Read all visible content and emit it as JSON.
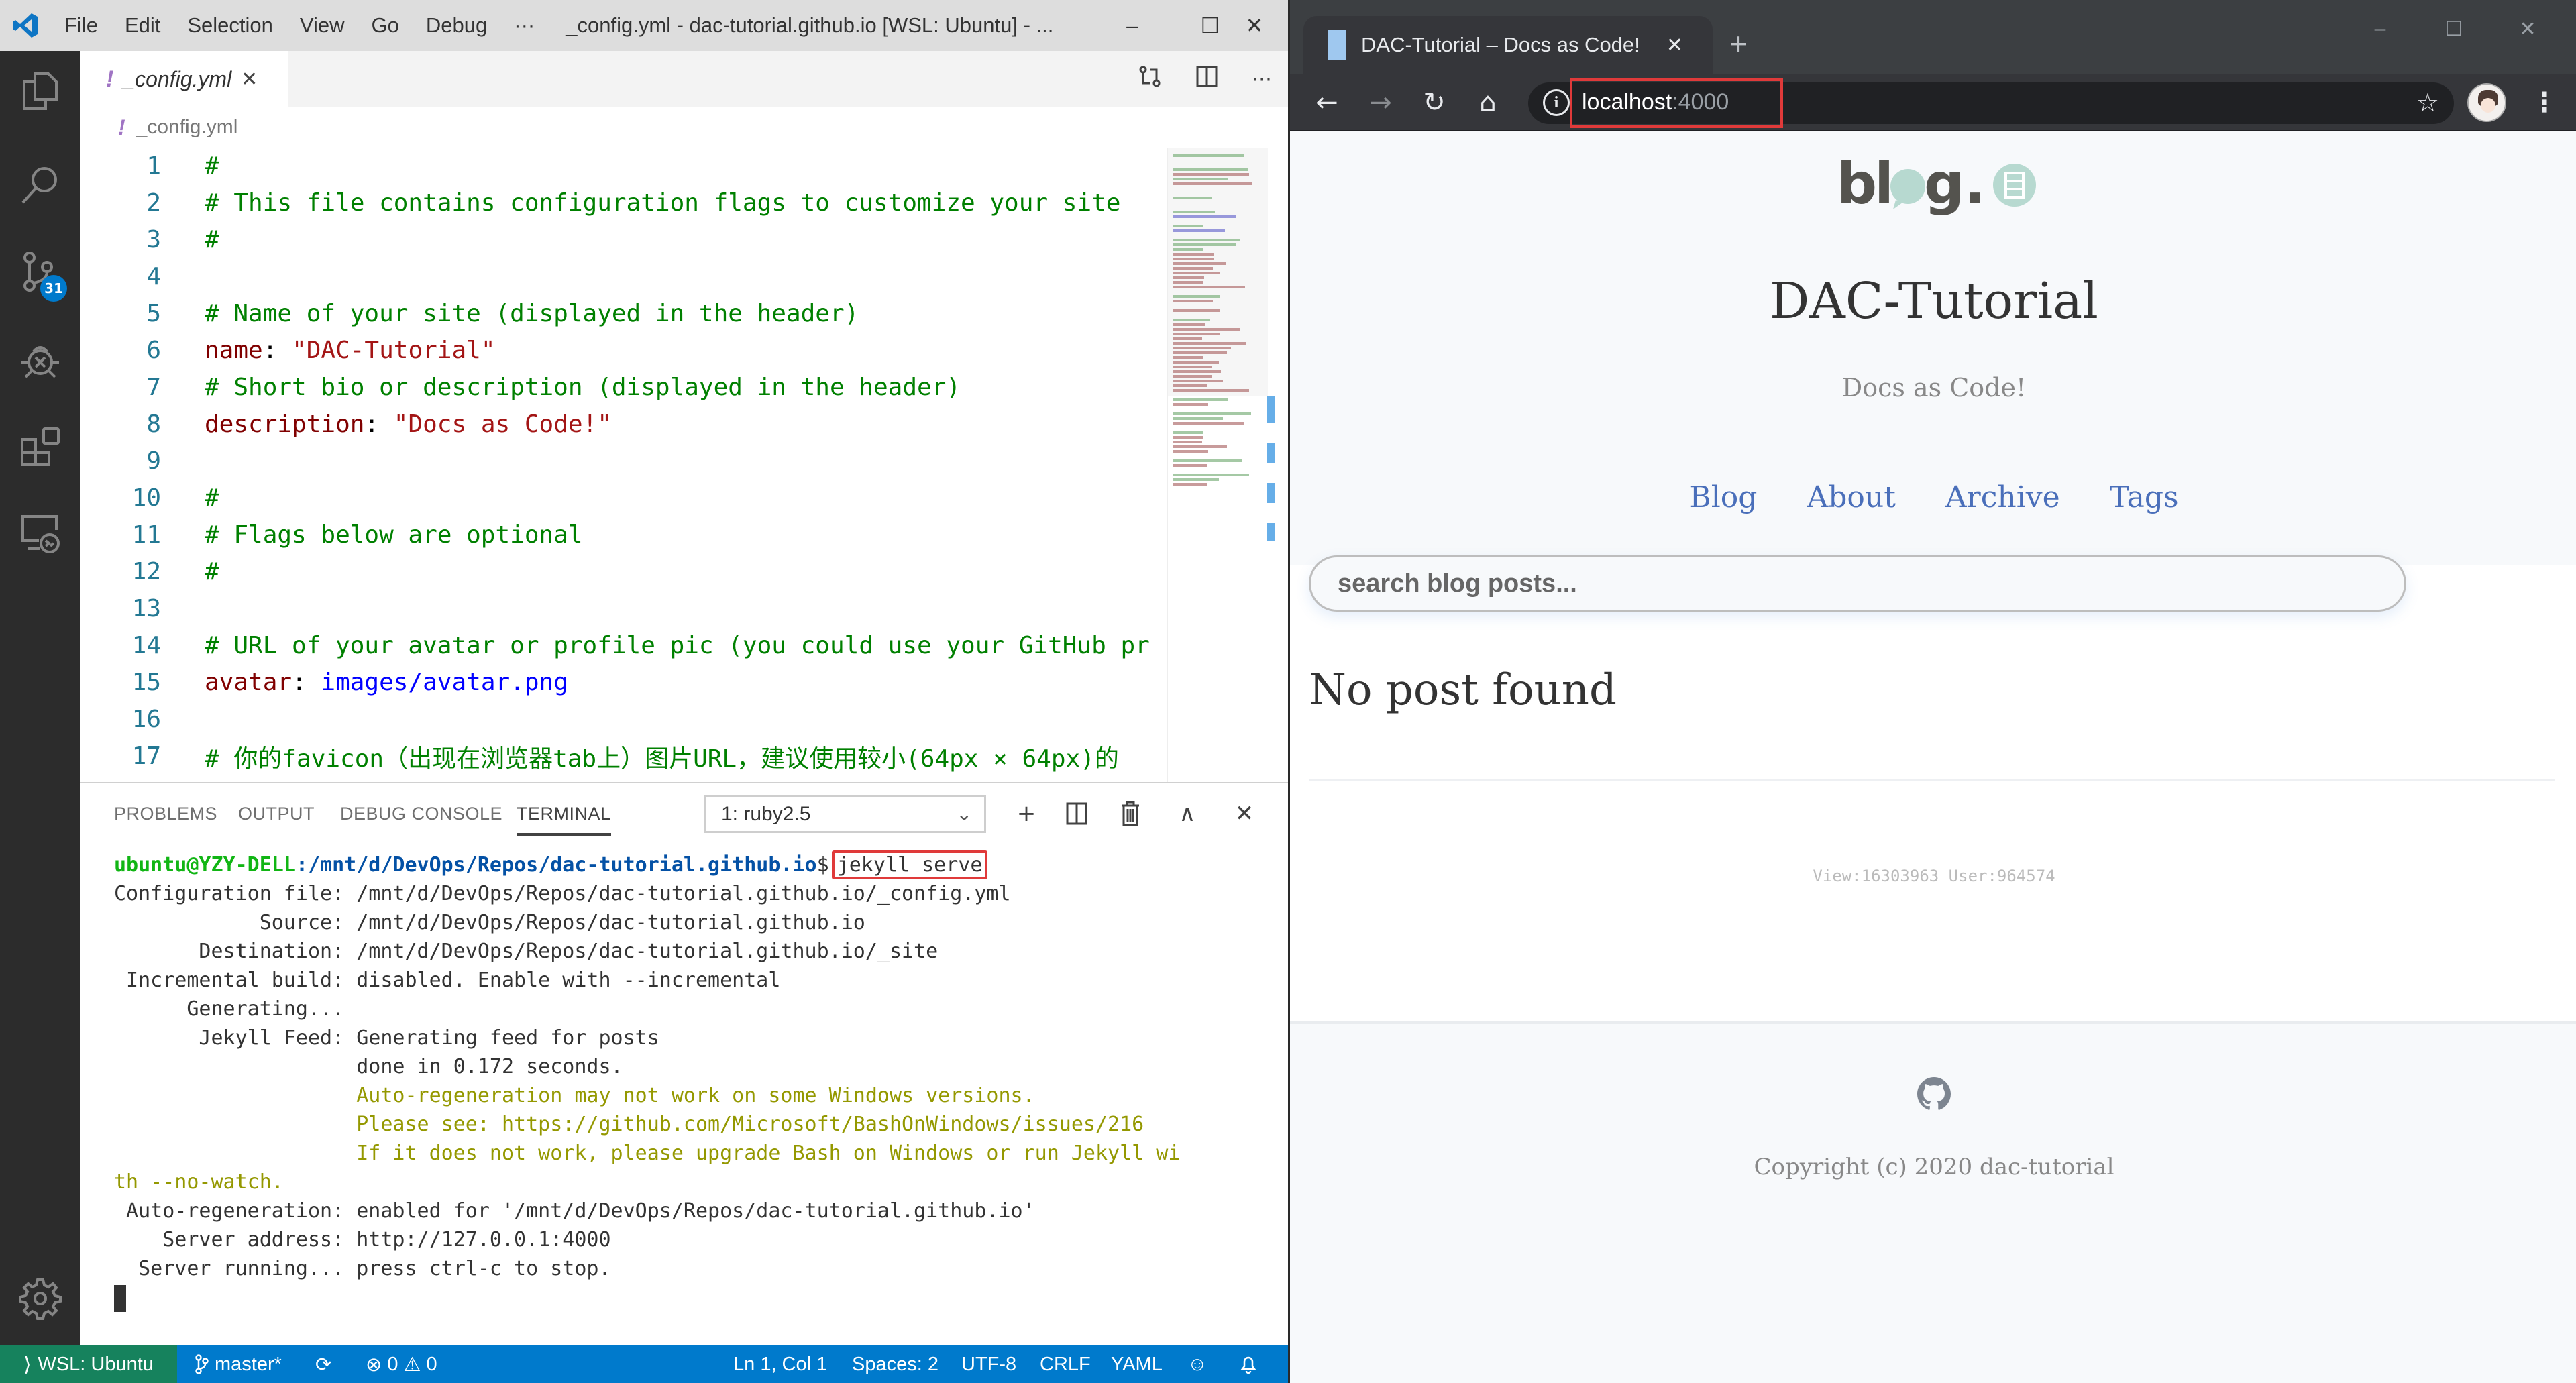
{
  "vscode": {
    "window_title": "_config.yml - dac-tutorial.github.io [WSL: Ubuntu] - ...",
    "menu": [
      "File",
      "Edit",
      "Selection",
      "View",
      "Go",
      "Debug",
      "···"
    ],
    "window_controls": {
      "minimize": "–",
      "maximize": "☐",
      "close": "✕"
    },
    "activity_bar": [
      {
        "name": "explorer-icon"
      },
      {
        "name": "search-icon"
      },
      {
        "name": "source-control-icon",
        "badge": "31"
      },
      {
        "name": "debug-icon"
      },
      {
        "name": "extensions-icon"
      },
      {
        "name": "remote-explorer-icon"
      },
      {
        "name": "settings-gear-icon"
      }
    ],
    "tab": {
      "icon": "!",
      "label": "_config.yml",
      "close": "✕"
    },
    "breadcrumb": {
      "icon": "!",
      "label": "_config.yml"
    },
    "code_lines": [
      {
        "n": "1",
        "parts": [
          {
            "t": "#",
            "c": "comment"
          }
        ]
      },
      {
        "n": "2",
        "parts": [
          {
            "t": "# This file contains configuration flags to customize your site",
            "c": "comment"
          }
        ]
      },
      {
        "n": "3",
        "parts": [
          {
            "t": "#",
            "c": "comment"
          }
        ]
      },
      {
        "n": "4",
        "parts": []
      },
      {
        "n": "5",
        "parts": [
          {
            "t": "# Name of your site (displayed in the header)",
            "c": "comment"
          }
        ]
      },
      {
        "n": "6",
        "parts": [
          {
            "t": "name",
            "c": "key"
          },
          {
            "t": ": ",
            "c": "plain"
          },
          {
            "t": "\"DAC-Tutorial\"",
            "c": "str"
          }
        ]
      },
      {
        "n": "7",
        "parts": [
          {
            "t": "# Short bio or description (displayed in the header)",
            "c": "comment"
          }
        ]
      },
      {
        "n": "8",
        "parts": [
          {
            "t": "description",
            "c": "key"
          },
          {
            "t": ": ",
            "c": "plain"
          },
          {
            "t": "\"Docs as Code!\"",
            "c": "str"
          }
        ]
      },
      {
        "n": "9",
        "parts": []
      },
      {
        "n": "10",
        "parts": [
          {
            "t": "#",
            "c": "comment"
          }
        ]
      },
      {
        "n": "11",
        "parts": [
          {
            "t": "# Flags below are optional",
            "c": "comment"
          }
        ]
      },
      {
        "n": "12",
        "parts": [
          {
            "t": "#",
            "c": "comment"
          }
        ]
      },
      {
        "n": "13",
        "parts": []
      },
      {
        "n": "14",
        "parts": [
          {
            "t": "# URL of your avatar or profile pic (you could use your GitHub pr",
            "c": "comment"
          }
        ]
      },
      {
        "n": "15",
        "parts": [
          {
            "t": "avatar",
            "c": "key"
          },
          {
            "t": ": ",
            "c": "plain"
          },
          {
            "t": "images/avatar.png",
            "c": "val"
          }
        ]
      },
      {
        "n": "16",
        "parts": []
      },
      {
        "n": "17",
        "parts": [
          {
            "t": "# 你的favicon（出现在浏览器tab上）图片URL，建议使用较小(64px × 64px)的",
            "c": "comment"
          }
        ]
      }
    ],
    "panel": {
      "tabs": [
        "PROBLEMS",
        "OUTPUT",
        "DEBUG CONSOLE",
        "TERMINAL"
      ],
      "active_tab": "TERMINAL",
      "terminal_select": "1: ruby2.5",
      "actions": {
        "add": "+",
        "split": "◫",
        "trash": "🗑",
        "maximize": "∧",
        "close": "✕"
      }
    },
    "terminal": {
      "prompt_user": "ubuntu@YZY-DELL",
      "prompt_path": ":/mnt/d/DevOps/Repos/dac-tutorial.github.io",
      "prompt_sign": "$",
      "command": "jekyll serve",
      "lines": [
        {
          "t": "Configuration file: /mnt/d/DevOps/Repos/dac-tutorial.github.io/_config.yml",
          "c": "normal"
        },
        {
          "t": "            Source: /mnt/d/DevOps/Repos/dac-tutorial.github.io",
          "c": "normal"
        },
        {
          "t": "       Destination: /mnt/d/DevOps/Repos/dac-tutorial.github.io/_site",
          "c": "normal"
        },
        {
          "t": " Incremental build: disabled. Enable with --incremental",
          "c": "normal"
        },
        {
          "t": "      Generating...",
          "c": "normal"
        },
        {
          "t": "       Jekyll Feed: Generating feed for posts",
          "c": "normal"
        },
        {
          "t": "                    done in 0.172 seconds.",
          "c": "normal"
        },
        {
          "t": "                    Auto-regeneration may not work on some Windows versions.",
          "c": "warn"
        },
        {
          "t": "                    Please see: https://github.com/Microsoft/BashOnWindows/issues/216",
          "c": "warn"
        },
        {
          "t": "                    If it does not work, please upgrade Bash on Windows or run Jekyll wi",
          "c": "warn"
        },
        {
          "t": "th --no-watch.",
          "c": "warn"
        },
        {
          "t": " Auto-regeneration: enabled for '/mnt/d/DevOps/Repos/dac-tutorial.github.io'",
          "c": "normal"
        },
        {
          "t": "    Server address: http://127.0.0.1:4000",
          "c": "normal"
        },
        {
          "t": "  Server running... press ctrl-c to stop.",
          "c": "normal"
        }
      ]
    },
    "statusbar": {
      "remote": "WSL: Ubuntu",
      "branch": "master*",
      "errors": "0",
      "warnings": "0",
      "position": "Ln 1, Col 1",
      "spaces": "Spaces: 2",
      "encoding": "UTF-8",
      "eol": "CRLF",
      "language": "YAML"
    }
  },
  "chrome": {
    "tab_title": "DAC-Tutorial – Docs as Code!",
    "tab_close": "✕",
    "new_tab": "+",
    "window_controls": {
      "minimize": "–",
      "maximize": "☐",
      "close": "✕"
    },
    "nav": {
      "back": "←",
      "forward": "→",
      "reload": "↻",
      "home": "⌂"
    },
    "url_host": "localhost",
    "url_port": ":4000",
    "bookmark_star": "☆",
    "menu": "⋮"
  },
  "site": {
    "logo_text": "blog.",
    "title": "DAC-Tutorial",
    "description": "Docs as Code!",
    "nav": [
      "Blog",
      "About",
      "Archive",
      "Tags"
    ],
    "search_placeholder": "search blog posts...",
    "no_post": "No post found",
    "counter": "View:16303963 User:964574",
    "copyright": "Copyright (c) 2020 dac-tutorial"
  },
  "colors": {
    "vscode_blue": "#007acc",
    "remote_green": "#16825d",
    "highlight_red": "#e03a3a",
    "link_blue": "#4a6fba"
  }
}
